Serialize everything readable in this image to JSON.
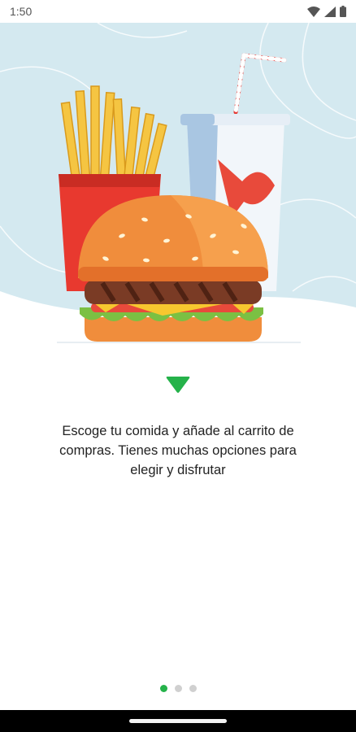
{
  "status_bar": {
    "time": "1:50",
    "icons": [
      "wifi-icon",
      "signal-icon",
      "battery-icon"
    ]
  },
  "onboarding": {
    "illustration": "fast-food-illustration",
    "description": "Escoge tu comida y añade al carrito de\ncompras. Tienes muchas opciones para\nelegir y disfrutar",
    "page_indicator": {
      "total": 3,
      "active_index": 0
    }
  },
  "colors": {
    "accent": "#25b24a",
    "hero_background": "#d4e9f0",
    "inactive_dot": "#d0d0d0"
  }
}
